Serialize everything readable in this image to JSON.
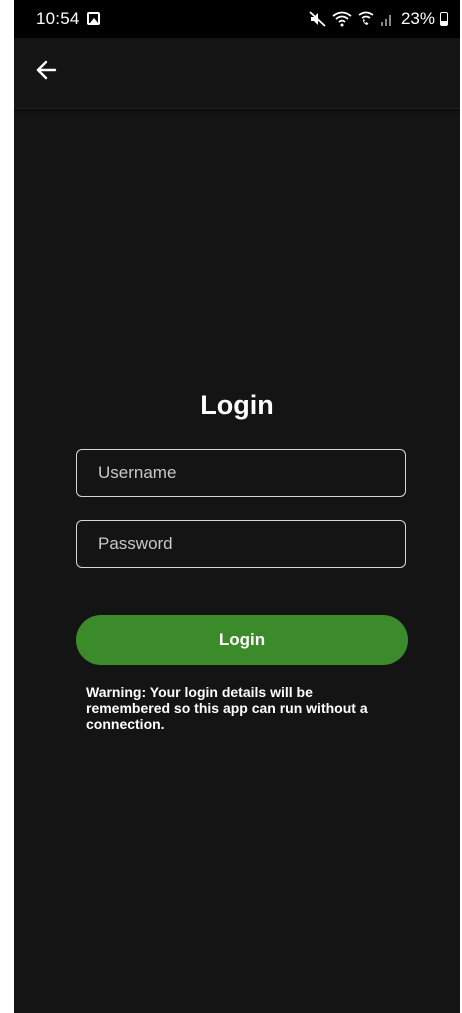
{
  "status_bar": {
    "time": "10:54",
    "battery": "23%",
    "icons": [
      "gallery-icon",
      "mute-icon",
      "wifi-icon",
      "wifi-calling-icon",
      "signal-icon",
      "battery-icon"
    ]
  },
  "app_bar": {
    "back_icon": "arrow-left-icon"
  },
  "login": {
    "title": "Login",
    "username_placeholder": "Username",
    "password_placeholder": "Password",
    "button_label": "Login",
    "warning": "Warning: Your login details will be remembered so this app can run without a connection."
  },
  "colors": {
    "background": "#141414",
    "status_bar": "#000000",
    "button": "#3b8b2b",
    "text": "#ffffff",
    "field_border": "#d6d6d6"
  }
}
